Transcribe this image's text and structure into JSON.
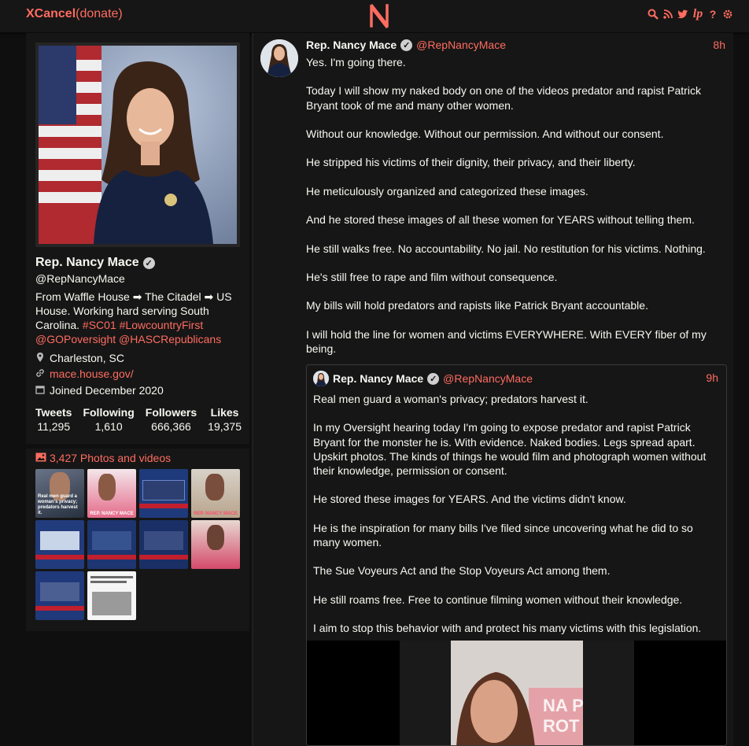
{
  "nav": {
    "brand_name": "XCancel",
    "brand_suffix": "(donate)",
    "logo_letter": "N",
    "icons": [
      "search-icon",
      "rss-icon",
      "bird-icon",
      "liberapay-icon",
      "help-icon",
      "gear-icon"
    ]
  },
  "profile": {
    "fullname": "Rep. Nancy Mace",
    "handle": "@RepNancyMace",
    "bio_text": "From Waffle House ➡ The Citadel ➡ US House. Working hard serving South Carolina.",
    "bio_links": [
      "#SC01",
      "#LowcountryFirst",
      "@GOPoversight",
      "@HASCRepublicans"
    ],
    "location": "Charleston, SC",
    "website": "mace.house.gov/",
    "joined": "Joined December 2020",
    "stats": [
      {
        "label": "Tweets",
        "value": "11,295"
      },
      {
        "label": "Following",
        "value": "1,610"
      },
      {
        "label": "Followers",
        "value": "666,366"
      },
      {
        "label": "Likes",
        "value": "19,375"
      }
    ]
  },
  "media": {
    "title": "3,427 Photos and videos",
    "thumbs": [
      {
        "caption": "Real men guard a woman's privacy; predators harvest it."
      },
      {
        "caption": "REP. NANCY MACE"
      },
      {
        "caption": ""
      },
      {
        "caption": "REP. NANCY MACE"
      },
      {
        "caption": ""
      },
      {
        "caption": ""
      },
      {
        "caption": ""
      },
      {
        "caption": ""
      },
      {
        "caption": ""
      },
      {
        "caption": ""
      }
    ]
  },
  "tweet": {
    "fullname": "Rep. Nancy Mace",
    "handle": "@RepNancyMace",
    "date": "8h",
    "paragraphs": [
      "Yes. I'm going there.",
      "Today I will show my naked body on one of the videos predator and rapist Patrick Bryant took of me and many other women.",
      "Without our knowledge. Without our permission. And without our consent.",
      "He stripped his victims of their dignity, their privacy, and their liberty.",
      "He meticulously organized and categorized these images.",
      "And he stored these images of all these women for YEARS without telling them.",
      "He still walks free. No accountability. No jail. No restitution for his victims. Nothing.",
      "He's still free to rape and film without consequence.",
      "My bills will hold predators and rapists like Patrick Bryant accountable.",
      "I will hold the line for women and victims EVERYWHERE. With EVERY fiber of my being."
    ]
  },
  "quote": {
    "fullname": "Rep. Nancy Mace",
    "handle": "@RepNancyMace",
    "date": "9h",
    "paragraphs": [
      "Real men guard a woman's privacy; predators harvest it.",
      "In my Oversight hearing today I'm going to expose predator and rapist Patrick Bryant for the monster he is. With evidence. Naked bodies. Legs spread apart. Upskirt photos. The kinds of things he would film and photograph women without their knowledge, permission or consent.",
      "He stored these images for YEARS. And the victims didn't know.",
      "He is the inspiration for many bills I've filed since uncovering what he did to so many women.",
      "The Sue Voyeurs Act and the Stop Voyeurs Act among them.",
      "He still roams free. Free to continue filming women without their knowledge.",
      "I aim to stop this behavior with and protect his many victims with this legislation."
    ],
    "media_sign_text": "NA PROTE"
  },
  "colors": {
    "accent": "#ff6c60",
    "background": "#0f0f0f",
    "panel": "#161616",
    "text": "#f8f8f2"
  }
}
